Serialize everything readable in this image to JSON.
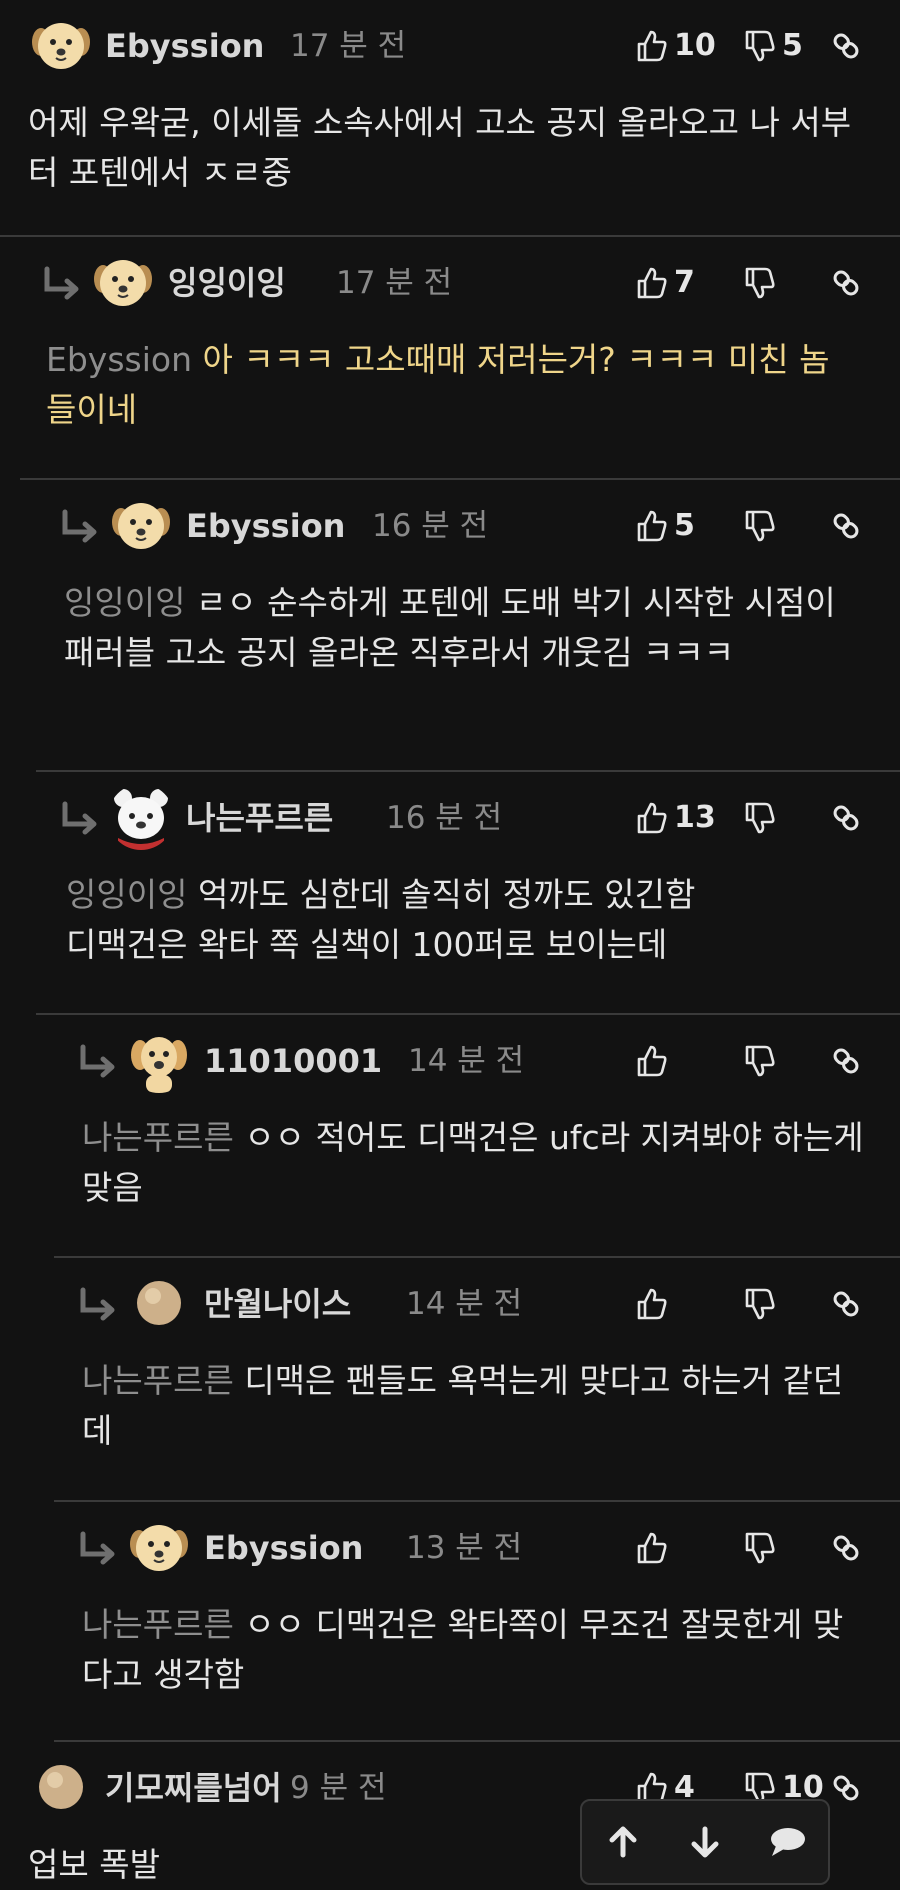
{
  "comments": [
    {
      "user": "Ebyssion",
      "time": "17 분 전",
      "likes": "10",
      "dislikes": "5",
      "avatar": "puppy",
      "mention": "",
      "text": "어제 우왁굳, 이세돌 소속사에서 고소 공지 올라오고 나 서부터 포텐에서 ㅈㄹ중",
      "highlight": false
    },
    {
      "user": "잉잉이잉",
      "time": "17 분 전",
      "likes": "7",
      "dislikes": "",
      "avatar": "puppy",
      "mention": "Ebyssion",
      "text": "아 ㅋㅋㅋ 고소때매 저러는거? ㅋㅋㅋ 미친 놈들이네",
      "highlight": true
    },
    {
      "user": "Ebyssion",
      "time": "16 분 전",
      "likes": "5",
      "dislikes": "",
      "avatar": "puppy",
      "mention": "잉잉이잉",
      "text": "ㄹㅇ 순수하게 포텐에 도배 박기 시작한 시점이 패러블 고소 공지 올라온 직후라서 개웃김 ㅋㅋㅋ",
      "highlight": false
    },
    {
      "user": "나는푸르른",
      "time": "16 분 전",
      "likes": "13",
      "dislikes": "",
      "avatar": "bear",
      "mention": "잉잉이잉",
      "text": "억까도 심한데 솔직히 정까도 있긴함\n디맥건은 왁타 쪽 실책이 100퍼로 보이는데",
      "highlight": false
    },
    {
      "user": "11010001",
      "time": "14 분 전",
      "likes": "",
      "dislikes": "",
      "avatar": "labrador",
      "mention": "나는푸르른",
      "text": "ㅇㅇ 적어도 디맥건은 ufc라 지켜봐야 하는게 맞음",
      "highlight": false
    },
    {
      "user": "만월나이스",
      "time": "14 분 전",
      "likes": "",
      "dislikes": "",
      "avatar": "beige",
      "mention": "나는푸르른",
      "text": "디맥은 팬들도 욕먹는게 맞다고 하는거 같던데",
      "highlight": false
    },
    {
      "user": "Ebyssion",
      "time": "13 분 전",
      "likes": "",
      "dislikes": "",
      "avatar": "puppy",
      "mention": "나는푸르른",
      "text": "ㅇㅇ 디맥건은 왁타쪽이 무조건 잘못한게 맞다고 생각함",
      "highlight": false
    },
    {
      "user": "기모찌를넘어",
      "time": "9 분 전",
      "likes": "4",
      "dislikes": "10",
      "avatar": "beige",
      "mention": "",
      "text": "업보 폭발",
      "highlight": false
    }
  ],
  "fab": {
    "up": "arrow-up-icon",
    "down": "arrow-down-icon",
    "chat": "chat-bubble-icon"
  },
  "colors": {
    "background": "#121212",
    "text": "#e6e6e6",
    "muted": "#8a8a8a",
    "highlight": "#efd58a",
    "divider": "#3a3a3a"
  }
}
